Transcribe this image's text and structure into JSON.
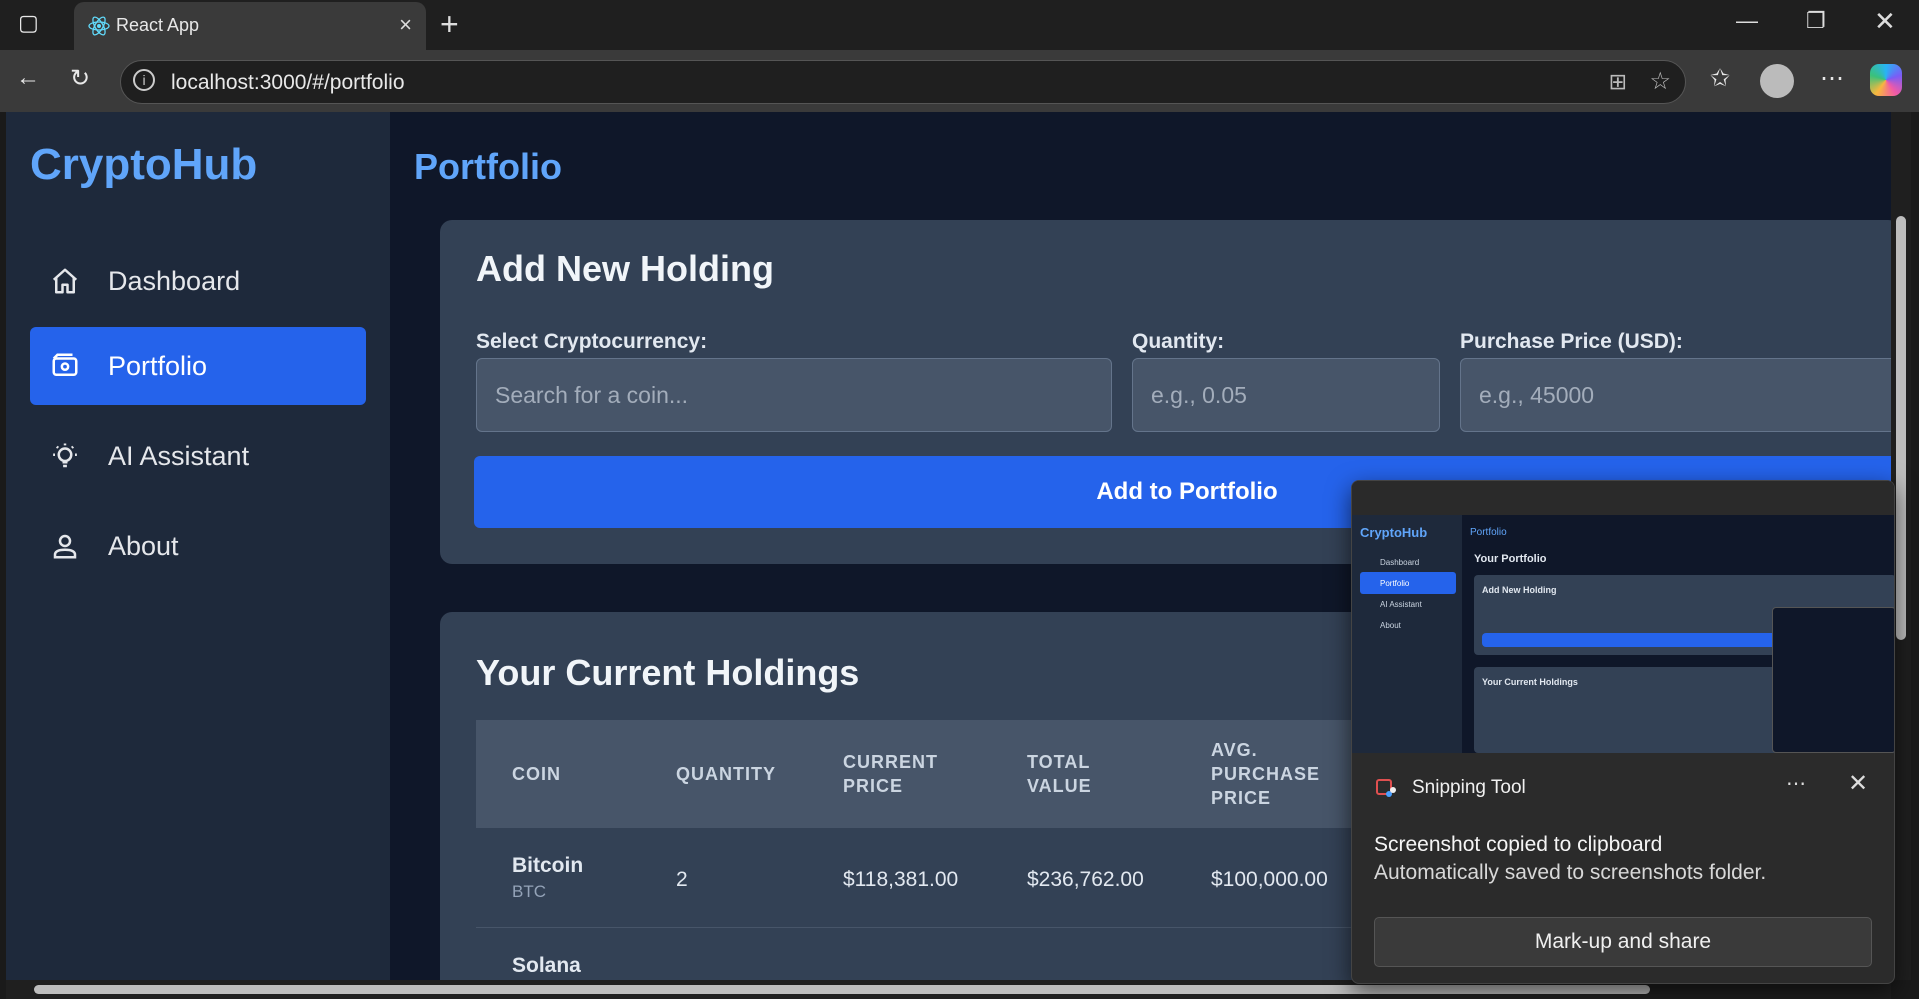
{
  "browser": {
    "tab_title": "React App",
    "url": "localhost:3000/#/portfolio"
  },
  "sidebar": {
    "brand": "CryptoHub",
    "items": [
      {
        "label": "Dashboard",
        "icon": "home-icon"
      },
      {
        "label": "Portfolio",
        "icon": "wallet-icon",
        "active": true
      },
      {
        "label": "AI Assistant",
        "icon": "lightbulb-icon"
      },
      {
        "label": "About",
        "icon": "user-icon"
      }
    ]
  },
  "main": {
    "title": "Portfolio",
    "add_holding": {
      "title": "Add New Holding",
      "coin_label": "Select Cryptocurrency:",
      "coin_placeholder": "Search for a coin...",
      "quantity_label": "Quantity:",
      "quantity_placeholder": "e.g., 0.05",
      "price_label": "Purchase Price (USD):",
      "price_placeholder": "e.g., 45000",
      "button": "Add to Portfolio"
    },
    "holdings": {
      "title": "Your Current Holdings",
      "columns": [
        "COIN",
        "QUANTITY",
        "CURRENT PRICE",
        "TOTAL VALUE",
        "AVG. PURCHASE PRICE"
      ],
      "rows": [
        {
          "name": "Bitcoin",
          "symbol": "BTC",
          "quantity": "2",
          "current_price": "$118,381.00",
          "total_value": "$236,762.00",
          "avg_price": "$100,000.00"
        },
        {
          "name": "Solana",
          "symbol": "",
          "quantity": "",
          "current_price": "",
          "total_value": "",
          "avg_price": ""
        }
      ]
    }
  },
  "toast": {
    "app": "Snipping Tool",
    "title": "Screenshot copied to clipboard",
    "message": "Automatically saved to screenshots folder.",
    "button": "Mark-up and share",
    "preview": {
      "brand": "CryptoHub",
      "page_title": "Portfolio",
      "heading": "Your Portfolio",
      "card1": "Add New Holding",
      "card2": "Your Current Holdings",
      "nav": [
        "Dashboard",
        "Portfolio",
        "AI Assistant",
        "About"
      ]
    }
  },
  "colors": {
    "accent": "#2563eb",
    "brand": "#60a5fa",
    "page_bg": "#0f1729",
    "sidebar_bg": "#1e293b",
    "card_bg": "#334155"
  }
}
